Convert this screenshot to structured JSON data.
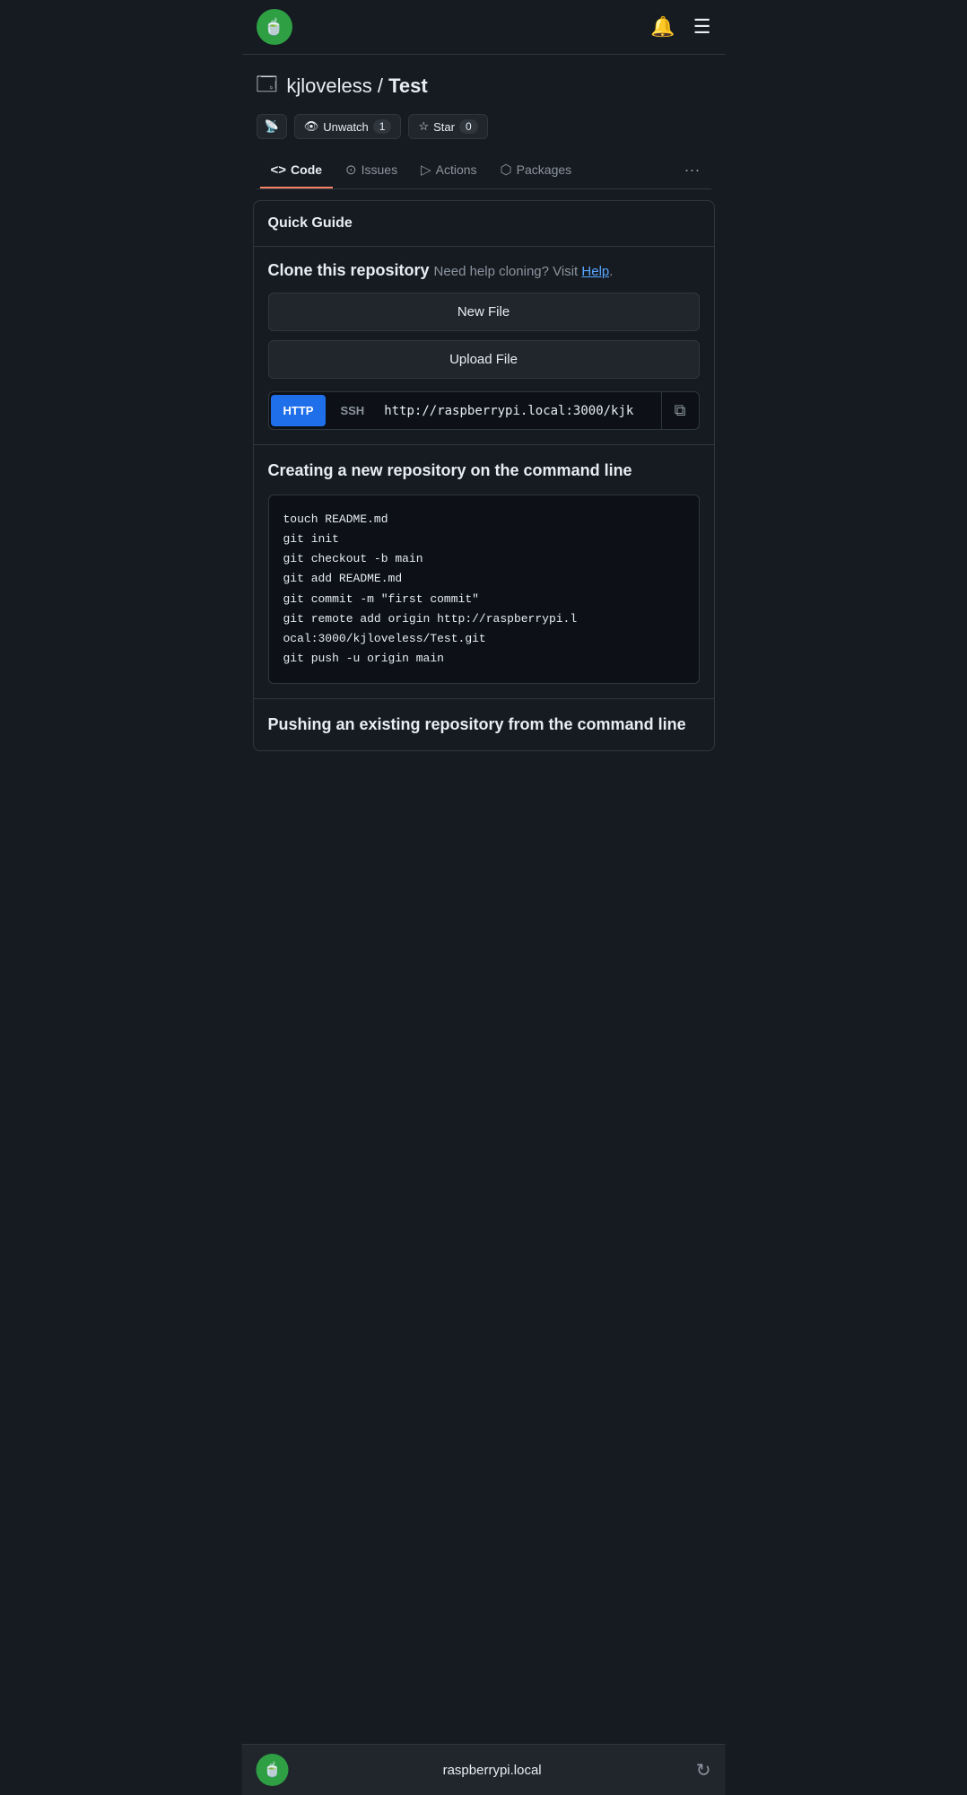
{
  "topnav": {
    "logo_emoji": "🍵",
    "bell_icon": "🔔",
    "menu_icon": "☰"
  },
  "repo": {
    "icon": "⬜",
    "owner": "kjloveless",
    "separator": " / ",
    "name": "Test"
  },
  "actions_row": {
    "rss_icon": "📡",
    "unwatch_label": "Unwatch",
    "unwatch_count": "1",
    "star_label": "Star",
    "star_count": "0"
  },
  "tabs": [
    {
      "id": "code",
      "icon": "<>",
      "label": "Code",
      "active": true
    },
    {
      "id": "issues",
      "icon": "⊙",
      "label": "Issues",
      "active": false
    },
    {
      "id": "actions",
      "icon": "▷",
      "label": "Actions",
      "active": false
    },
    {
      "id": "packages",
      "icon": "⬡",
      "label": "Packages",
      "active": false
    }
  ],
  "tabs_more": "···",
  "quick_guide": {
    "header": "Quick Guide"
  },
  "clone_section": {
    "title": "Clone this repository",
    "help_prefix": "Need help cloning? Visit ",
    "help_link_text": "Help",
    "help_suffix": ".",
    "new_file_label": "New File",
    "upload_file_label": "Upload File",
    "proto_http": "HTTP",
    "proto_ssh": "SSH",
    "url": "http://raspberrypi.local:3000/kjk",
    "copy_icon": "⧉"
  },
  "command_section": {
    "title": "Creating a new repository on the command line",
    "code_lines": [
      "touch README.md",
      "git init",
      "git checkout -b main",
      "git add README.md",
      "git commit -m \"first commit\"",
      "git remote add origin http://raspberrypi.l",
      "ocal:3000/kjloveless/Test.git",
      "git push -u origin main"
    ]
  },
  "push_section": {
    "title": "Pushing an existing repository from the command line"
  },
  "bottom_bar": {
    "logo_emoji": "🍵",
    "url_label": "raspberrypi.local",
    "refresh_icon": "↻"
  }
}
